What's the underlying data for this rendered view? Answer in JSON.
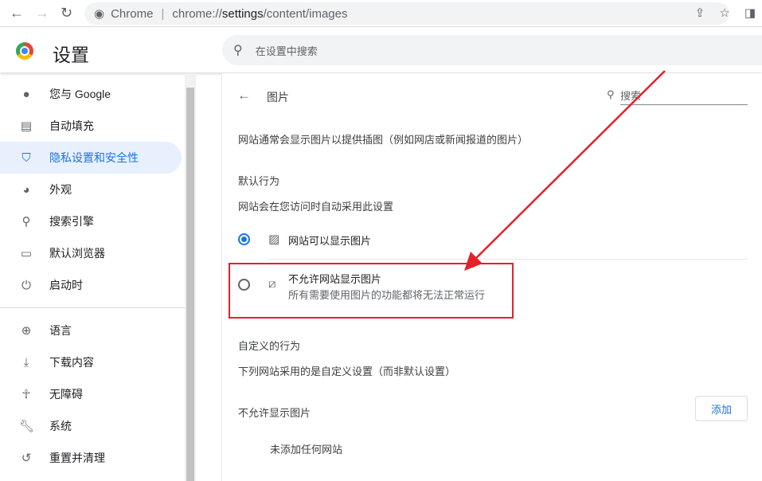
{
  "browser": {
    "site_label": "Chrome",
    "url_prefix": "chrome://",
    "url_bold": "settings",
    "url_rest": "/content/images"
  },
  "header": {
    "title": "设置",
    "search_placeholder": "在设置中搜索"
  },
  "sidebar": {
    "items": [
      {
        "label": "您与 Google",
        "icon": "person-icon"
      },
      {
        "label": "自动填充",
        "icon": "clipboard-icon"
      },
      {
        "label": "隐私设置和安全性",
        "icon": "shield-icon",
        "active": true
      },
      {
        "label": "外观",
        "icon": "palette-icon"
      },
      {
        "label": "搜索引擎",
        "icon": "search-icon"
      },
      {
        "label": "默认浏览器",
        "icon": "browser-icon"
      },
      {
        "label": "启动时",
        "icon": "power-icon"
      },
      {
        "label": "语言",
        "icon": "globe-icon"
      },
      {
        "label": "下载内容",
        "icon": "download-icon"
      },
      {
        "label": "无障碍",
        "icon": "accessibility-icon"
      },
      {
        "label": "系统",
        "icon": "wrench-icon"
      },
      {
        "label": "重置并清理",
        "icon": "history-icon"
      }
    ]
  },
  "main": {
    "page_title": "图片",
    "search_label": "搜索",
    "description": "网站通常会显示图片以提供插图（例如网店或新闻报道的图片）",
    "default_heading": "默认行为",
    "default_sub": "网站会在您访问时自动采用此设置",
    "option_allow": "网站可以显示图片",
    "option_block": "不允许网站显示图片",
    "option_block_sub": "所有需要使用图片的功能都将无法正常运行",
    "custom_heading": "自定义的行为",
    "custom_sub": "下列网站采用的是自定义设置（而非默认设置）",
    "block_list_heading": "不允许显示图片",
    "add_button": "添加",
    "empty_text": "未添加任何网站"
  },
  "colors": {
    "accent": "#1a73e8",
    "annotation": "#e5202a"
  }
}
